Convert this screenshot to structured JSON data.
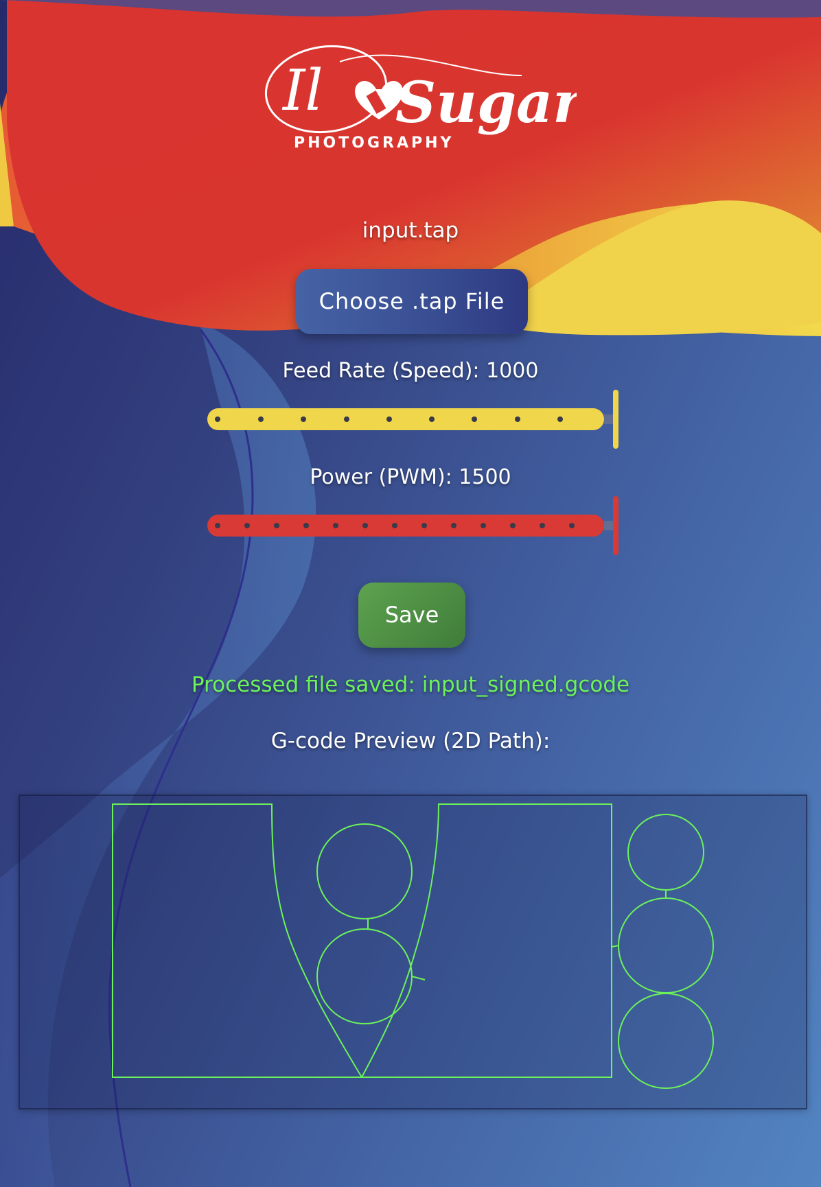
{
  "brand": {
    "logo_script": "Il Sugar",
    "logo_caption": "PHOTOGRAPHY"
  },
  "file": {
    "current_name": "input.tap",
    "choose_button_label": "Choose .tap File"
  },
  "feed_rate": {
    "label": "Feed Rate (Speed): 1000",
    "value": 1000,
    "fill_fraction": 1.0,
    "color": "#f0d64a"
  },
  "power": {
    "label": "Power (PWM): 1500",
    "value": 1500,
    "fill_fraction": 1.0,
    "color": "#d93a35"
  },
  "save": {
    "button_label": "Save"
  },
  "status": {
    "message": "Processed file saved: input_signed.gcode",
    "color": "#6cf25a"
  },
  "preview": {
    "title": "G-code Preview (2D Path):",
    "stroke_color": "#6cf25a"
  },
  "icons": [
    "heart-film-icon"
  ]
}
